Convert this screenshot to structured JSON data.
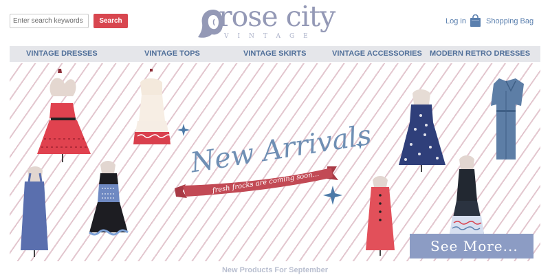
{
  "header": {
    "search_placeholder": "Enter search keywords h",
    "search_button": "Search",
    "logo_main": "rose city",
    "logo_sub": "VINTAGE",
    "login": "Log in",
    "bag_icon": "shopping-bag-icon",
    "shopping_bag": "Shopping Bag"
  },
  "nav": {
    "items": [
      {
        "label": "VINTAGE DRESSES"
      },
      {
        "label": "VINTAGE TOPS"
      },
      {
        "label": "VINTAGE SKIRTS"
      },
      {
        "label": "VINTAGE ACCESSORIES"
      },
      {
        "label": "MODERN RETRO DRESSES"
      }
    ]
  },
  "banner": {
    "headline": "New Arrivals",
    "ribbon": "fresh frocks are coming soon...",
    "see_more": "See More..."
  },
  "section": {
    "title": "New Products For September"
  },
  "colors": {
    "accent_red": "#d8464f",
    "nav_text": "#51709a",
    "headline_blue": "#6f8fb4",
    "ribbon_red": "#c24a55",
    "see_more_bg": "#8c9cc4"
  }
}
